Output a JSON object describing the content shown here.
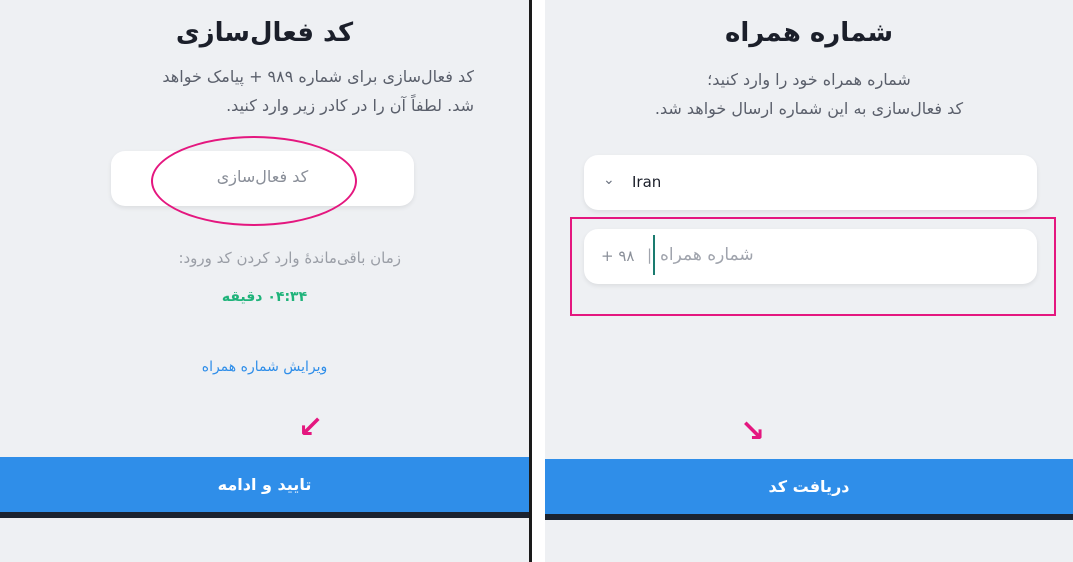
{
  "left": {
    "title": "کد فعال‌سازی",
    "desc_line1": "کد فعال‌سازی برای شماره ‎ ۹۸۹+ پیامک خواهد",
    "desc_line2": "شد. لطفاً آن را در کادر زیر وارد کنید.",
    "code_placeholder": "کد فعال‌سازی",
    "timer_label": "زمان باقی‌ماندهٔ وارد کردن کد ورود:",
    "timer_value": "۰۴:۳۴ دقیقه",
    "edit_link": "ویرایش شماره همراه",
    "confirm_button": "تایید و ادامه"
  },
  "right": {
    "title": "شماره همراه",
    "desc_line1": "شماره همراه خود را وارد کنید؛",
    "desc_line2": "کد فعال‌سازی به این شماره ارسال خواهد شد.",
    "country": "Iran",
    "country_code": "۹۸ +",
    "phone_placeholder": "شماره همراه",
    "get_code_button": "دریافت کد"
  },
  "colors": {
    "accent_blue": "#2f8ee9",
    "timer_green": "#1fb37a",
    "annotation_pink": "#e4177f"
  }
}
